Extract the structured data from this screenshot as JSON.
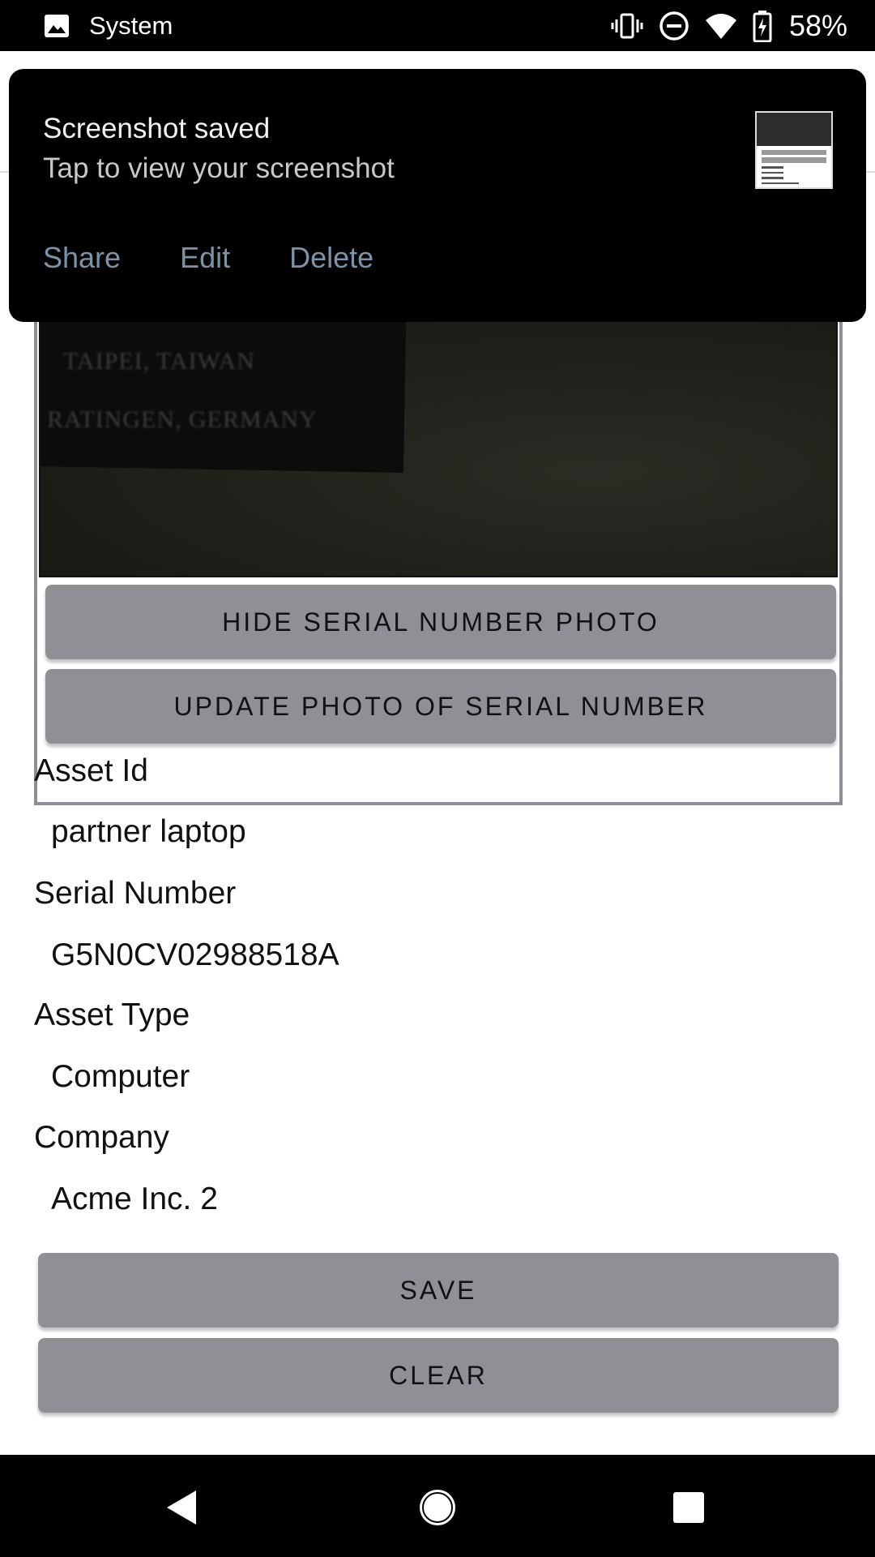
{
  "status_bar": {
    "app_label": "System",
    "icons": [
      "image-icon",
      "vibrate-icon",
      "do-not-disturb-icon",
      "wifi-icon",
      "battery-charging-icon"
    ],
    "battery": "58%"
  },
  "notification": {
    "title": "Screenshot saved",
    "subtitle": "Tap to view your screenshot",
    "actions": [
      "Share",
      "Edit",
      "Delete"
    ],
    "action_color": "#7c93a7"
  },
  "photo": {
    "text_line_1": "TAIPEI, TAIWAN",
    "text_line_2": "RATINGEN, GERMANY",
    "hide_button": "HIDE SERIAL NUMBER PHOTO",
    "update_button": "UPDATE PHOTO OF SERIAL NUMBER"
  },
  "fields": [
    {
      "label": "Asset Id",
      "value": "partner laptop"
    },
    {
      "label": "Serial Number",
      "value": "G5N0CV02988518A"
    },
    {
      "label": "Asset Type",
      "value": "Computer"
    },
    {
      "label": "Company",
      "value": "Acme Inc. 2"
    }
  ],
  "actions": {
    "save": "SAVE",
    "clear": "CLEAR"
  },
  "colors": {
    "button_bg": "#8e9096",
    "status_bar_bg": "#000000"
  }
}
